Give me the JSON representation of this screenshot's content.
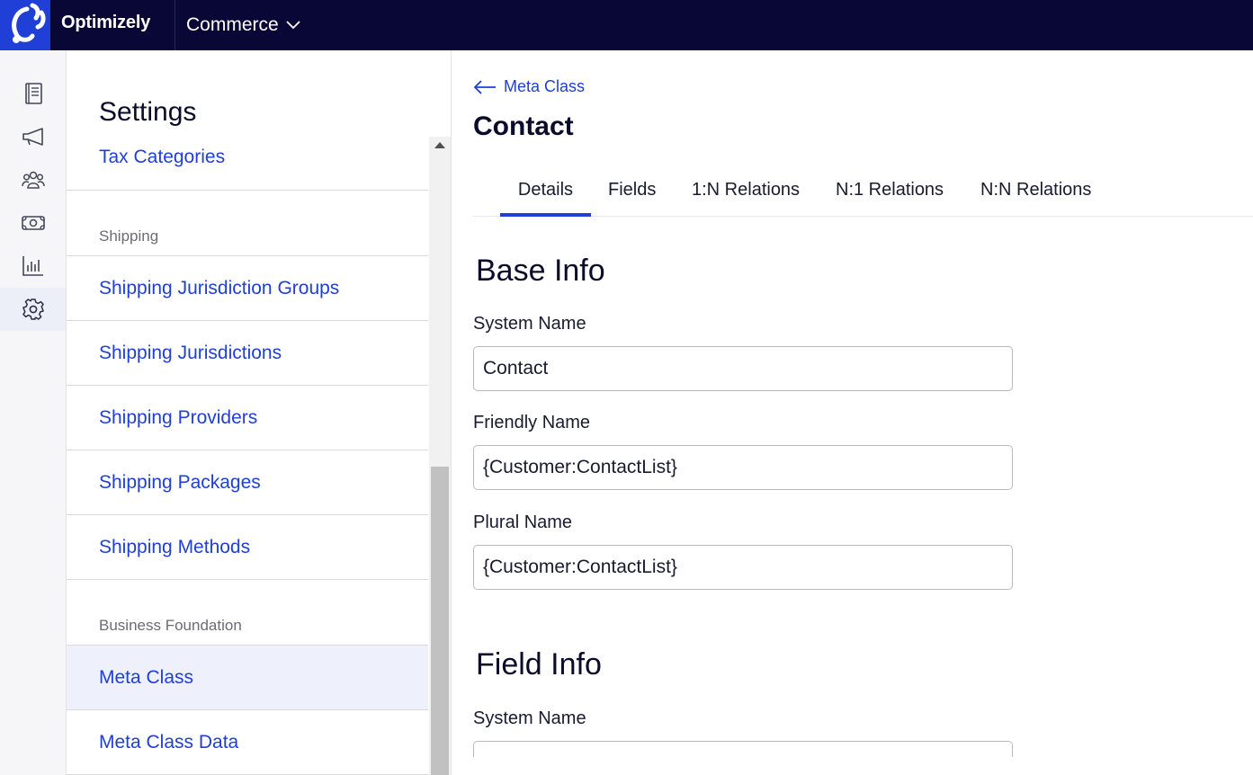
{
  "header": {
    "brand": "Optimizely",
    "product": "Commerce",
    "colors": {
      "bar": "#080736",
      "logo_bg": "#1f3fd6"
    }
  },
  "rail": {
    "items": [
      {
        "icon": "catalog-book-icon"
      },
      {
        "icon": "megaphone-icon"
      },
      {
        "icon": "customers-group-icon"
      },
      {
        "icon": "money-icon"
      },
      {
        "icon": "bar-chart-icon"
      },
      {
        "icon": "gear-icon",
        "active": true
      }
    ]
  },
  "settings": {
    "title": "Settings",
    "top_link": "Tax Categories",
    "sections": [
      {
        "heading": "Shipping",
        "items": [
          "Shipping Jurisdiction Groups",
          "Shipping Jurisdictions",
          "Shipping Providers",
          "Shipping Packages",
          "Shipping Methods"
        ]
      },
      {
        "heading": "Business Foundation",
        "items": [
          "Meta Class",
          "Meta Class Data"
        ],
        "active_item": "Meta Class"
      }
    ]
  },
  "main": {
    "back_label": "Meta Class",
    "title": "Contact",
    "tabs": [
      "Details",
      "Fields",
      "1:N Relations",
      "N:1 Relations",
      "N:N Relations"
    ],
    "active_tab": "Details",
    "base_info": {
      "title": "Base Info",
      "fields": [
        {
          "label": "System Name",
          "value": "Contact"
        },
        {
          "label": "Friendly Name",
          "value": "{Customer:ContactList}"
        },
        {
          "label": "Plural Name",
          "value": "{Customer:ContactList}"
        }
      ]
    },
    "field_info": {
      "title": "Field Info",
      "fields": [
        {
          "label": "System Name",
          "value": ""
        }
      ]
    }
  }
}
